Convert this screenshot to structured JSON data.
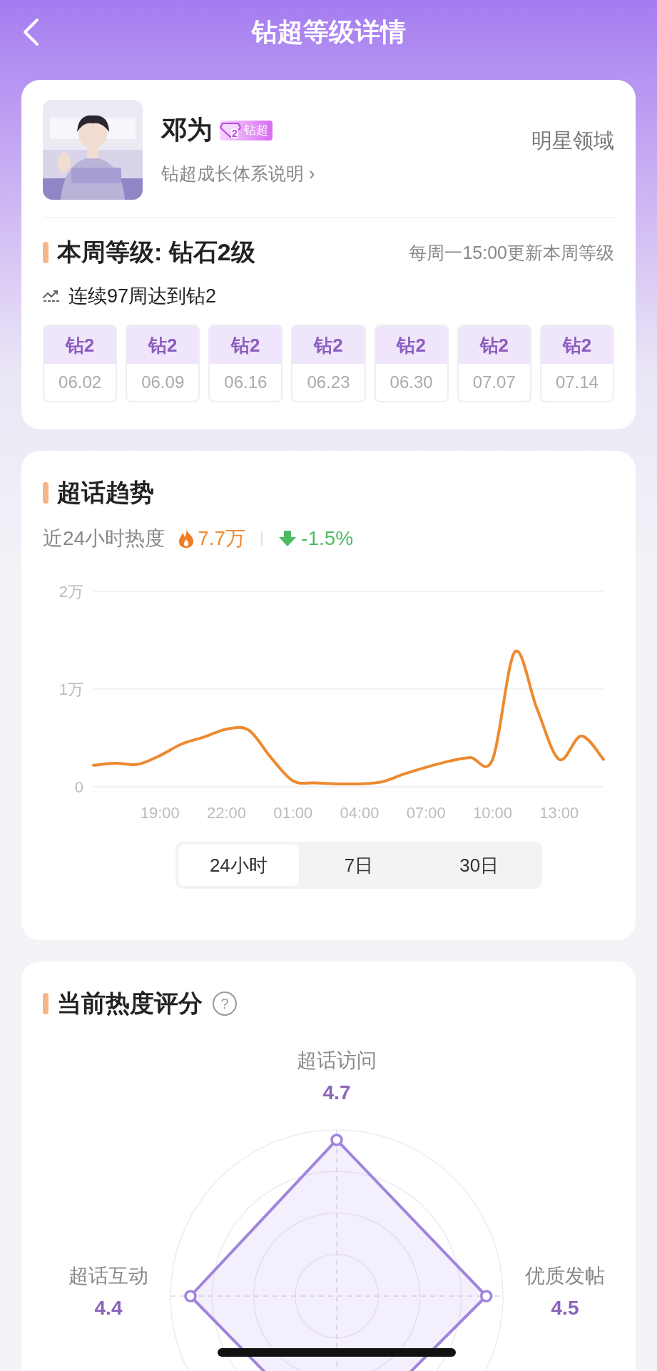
{
  "header": {
    "title": "钻超等级详情"
  },
  "profile": {
    "name": "邓为",
    "badge": {
      "number": "2",
      "label": "钻超"
    },
    "link": "钻超成长体系说明",
    "chevron": "›",
    "domain": "明星领域"
  },
  "level": {
    "title": "本周等级: 钻石2级",
    "note": "每周一15:00更新本周等级",
    "streak": "连续97周达到钻2",
    "weeks": [
      {
        "grade": "钻2",
        "date": "06.02"
      },
      {
        "grade": "钻2",
        "date": "06.09"
      },
      {
        "grade": "钻2",
        "date": "06.16"
      },
      {
        "grade": "钻2",
        "date": "06.23"
      },
      {
        "grade": "钻2",
        "date": "06.30"
      },
      {
        "grade": "钻2",
        "date": "07.07"
      },
      {
        "grade": "钻2",
        "date": "07.14"
      }
    ]
  },
  "trend": {
    "title": "超话趋势",
    "period_label": "近24小时热度",
    "heat": "7.7万",
    "change": "-1.5%",
    "chart_data": {
      "type": "line",
      "categories": [
        null,
        null,
        null,
        "19:00",
        null,
        null,
        "22:00",
        null,
        null,
        "01:00",
        null,
        null,
        "04:00",
        null,
        null,
        "07:00",
        null,
        null,
        "10:00",
        null,
        null,
        "13:00",
        null,
        null
      ],
      "series": [
        {
          "color": "#ec8a2f",
          "values": [
            0.22,
            0.24,
            0.23,
            0.32,
            0.44,
            0.51,
            0.59,
            0.58,
            0.3,
            0.06,
            0.04,
            0.03,
            0.03,
            0.05,
            0.13,
            0.2,
            0.26,
            0.3,
            0.28,
            1.38,
            0.8,
            0.28,
            0.52,
            0.28
          ]
        }
      ],
      "ylim": [
        0,
        2
      ],
      "yticks": [
        {
          "value": 0,
          "label": "0"
        },
        {
          "value": 1,
          "label": "1万"
        },
        {
          "value": 2,
          "label": "2万"
        }
      ]
    },
    "ranges": [
      {
        "label": "24小时",
        "selected": true
      },
      {
        "label": "7日",
        "selected": false
      },
      {
        "label": "30日",
        "selected": false
      }
    ]
  },
  "score": {
    "title": "当前热度评分",
    "help": "?",
    "axes": [
      {
        "kind": "top",
        "label": "超话访问",
        "value": "4.7"
      },
      {
        "kind": "left",
        "label": "超话互动",
        "value": "4.4"
      },
      {
        "kind": "right",
        "label": "优质发帖",
        "value": "4.5"
      }
    ]
  }
}
